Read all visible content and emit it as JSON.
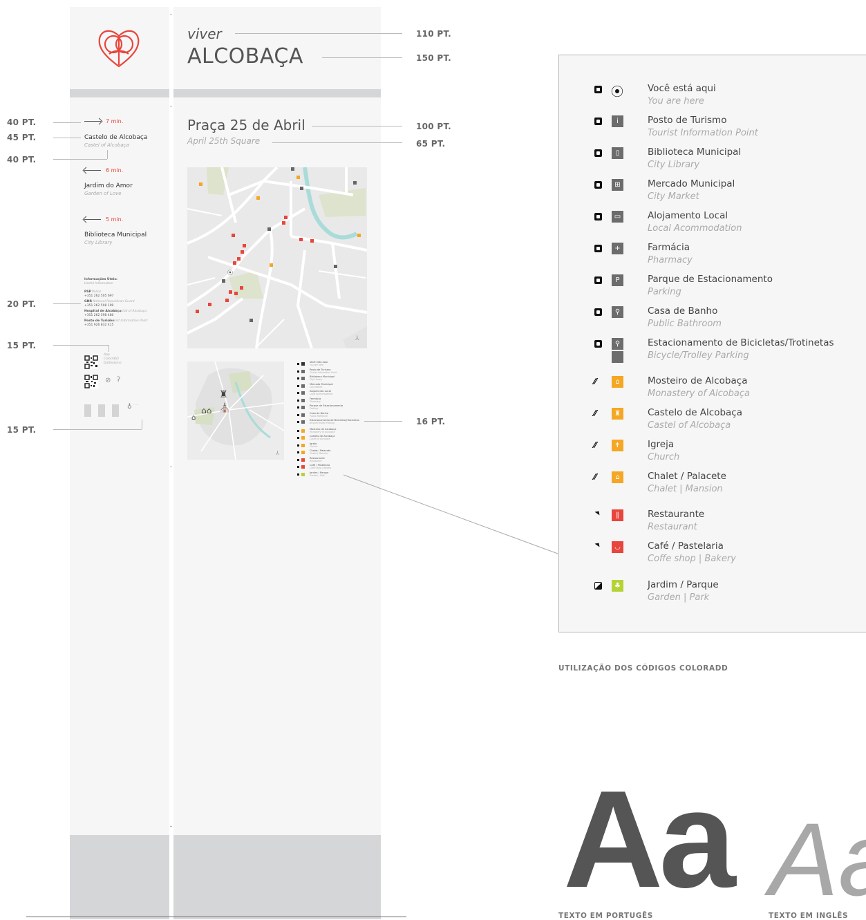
{
  "header": {
    "viver": "viver",
    "city": "ALCOBAÇA"
  },
  "location": {
    "title": "Praça 25 de Abril",
    "subtitle": "April 25th Square"
  },
  "directions": [
    {
      "time": "7 min.",
      "name": "Castelo de Alcobaça",
      "sub": "Castel of Alcobaça",
      "arrow": "right"
    },
    {
      "time": "6 min.",
      "name": "Jardim do Amor",
      "sub": "Garden of Love",
      "arrow": "left"
    },
    {
      "time": "5 min.",
      "name": "Biblioteca Municipal",
      "sub": "City Library",
      "arrow": "left"
    }
  ],
  "info": {
    "heading": "Informações Úteis:",
    "heading_sub": "Useful Information",
    "lines": [
      {
        "label": "PSP",
        "label_sub": "Police",
        "phone": "+351 262 505 697"
      },
      {
        "label": "GNR",
        "label_sub": "National Republican Guard",
        "phone": "+351 262 508 199"
      },
      {
        "label": "Hospital de Alcobaça",
        "label_sub": "Hospital of Alcobaça",
        "phone": "+351 262 598 480"
      },
      {
        "label": "Posto de Turismo",
        "label_sub": "Tourist Information Point",
        "phone": "+351 926 832 415"
      }
    ],
    "app_label": "App ColorADD Daltonismo"
  },
  "point_sizes": {
    "viver": "110 PT.",
    "city": "150 PT.",
    "title": "100 PT.",
    "subtitle": "65 PT.",
    "legend": "16 PT.",
    "dir_time": "40 PT.",
    "dir_name": "45 PT.",
    "dir_sub": "40 PT.",
    "info": "20 PT.",
    "qr": "15 PT.",
    "bottom": "15 PT."
  },
  "legend": [
    {
      "label": "Você está aqui",
      "sub": "You are here",
      "code": "black",
      "icon": "target-icon",
      "color": "none",
      "glyph": "⦿"
    },
    {
      "label": "Posto de Turismo",
      "sub": "Tourist Information Point",
      "code": "black",
      "icon": "info-icon",
      "color": "#6c6c6c",
      "glyph": "i"
    },
    {
      "label": "Biblioteca Municipal",
      "sub": "City Library",
      "code": "black",
      "icon": "book-icon",
      "color": "#6c6c6c",
      "glyph": "▯"
    },
    {
      "label": "Mercado Municipal",
      "sub": "City Market",
      "code": "black",
      "icon": "basket-icon",
      "color": "#6c6c6c",
      "glyph": "⊞"
    },
    {
      "label": "Alojamento Local",
      "sub": "Local  Acommodation",
      "code": "black",
      "icon": "bed-icon",
      "color": "#6c6c6c",
      "glyph": "▭"
    },
    {
      "label": "Farmácia",
      "sub": "Pharmacy",
      "code": "black",
      "icon": "cross-icon",
      "color": "#6c6c6c",
      "glyph": "+"
    },
    {
      "label": "Parque de Estacionamento",
      "sub": "Parking",
      "code": "black",
      "icon": "parking-icon",
      "color": "#6c6c6c",
      "glyph": "P"
    },
    {
      "label": "Casa de Banho",
      "sub": "Public Bathroom",
      "code": "black",
      "icon": "wc-icon",
      "color": "#6c6c6c",
      "glyph": "⚲"
    },
    {
      "label": "Estacionamento de Bicicletas/Trotinetas",
      "sub": "Bicycle/Trolley Parking",
      "code": "black",
      "icon": "bicycle-icon",
      "color": "#6c6c6c",
      "glyph": "⚲"
    },
    {
      "label": "Mosteiro de Alcobaça",
      "sub": "Monastery of Alcobaça",
      "code": "orange",
      "icon": "monastery-icon",
      "color": "#f5a623",
      "glyph": "⌂"
    },
    {
      "label": "Castelo de Alcobaça",
      "sub": "Castel of Alcobaça",
      "code": "orange",
      "icon": "castle-icon",
      "color": "#f5a623",
      "glyph": "♜"
    },
    {
      "label": "Igreja",
      "sub": "Church",
      "code": "orange",
      "icon": "church-icon",
      "color": "#f5a623",
      "glyph": "✝"
    },
    {
      "label": "Chalet / Palacete",
      "sub": "Chalet | Mansion",
      "code": "orange",
      "icon": "house-icon",
      "color": "#f5a623",
      "glyph": "⌂"
    },
    {
      "label": "Restaurante",
      "sub": "Restaurant",
      "code": "red",
      "icon": "cutlery-icon",
      "color": "#e8453c",
      "glyph": "‖"
    },
    {
      "label": "Café / Pastelaria",
      "sub": "Coffe shop | Bakery",
      "code": "red",
      "icon": "cup-icon",
      "color": "#e8453c",
      "glyph": "◡"
    },
    {
      "label": "Jardim / Parque",
      "sub": "Garden | Park",
      "code": "green",
      "icon": "tree-icon",
      "color": "#b5d335",
      "glyph": "♣"
    }
  ],
  "captions": {
    "colorADD": "UTILIZAÇÃO DOS CÓDIGOS COLORADD",
    "pt_text": "TEXTO EM PORTUGÊS",
    "en_text": "TEXTO EM INGLÊS"
  },
  "typography": {
    "sample_regular": "Aa",
    "sample_italic": "Aa"
  },
  "colors": {
    "accent_red": "#e8453c",
    "orange": "#f5a623",
    "lime": "#b5d335",
    "grey_icon": "#6c6c6c",
    "panel": "#f6f6f6",
    "band": "#d5d6d8"
  }
}
